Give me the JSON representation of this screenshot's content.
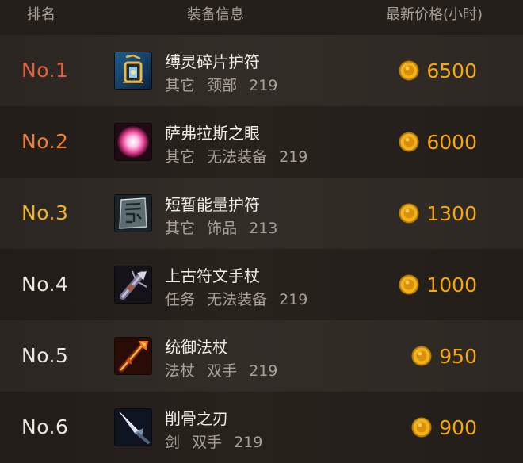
{
  "header": {
    "rank": "排名",
    "info": "装备信息",
    "price": "最新价格(小时)"
  },
  "colors": {
    "no1": "#e0603c",
    "no2": "#eb7f37",
    "no3": "#f0b324",
    "default": "#ece6df",
    "price": "#f4a80c"
  },
  "items": [
    {
      "rank": "No.1",
      "name": "缚灵碎片护符",
      "type": "其它",
      "slot": "颈部",
      "level": "219",
      "price": "6500",
      "icon": "amulet-icon"
    },
    {
      "rank": "No.2",
      "name": "萨弗拉斯之眼",
      "type": "其它",
      "slot": "无法装备",
      "level": "219",
      "price": "6000",
      "icon": "glowing-orb-icon"
    },
    {
      "rank": "No.3",
      "name": "短暂能量护符",
      "type": "其它",
      "slot": "饰品",
      "level": "213",
      "price": "1300",
      "icon": "rune-tablet-icon"
    },
    {
      "rank": "No.4",
      "name": "上古符文手杖",
      "type": "任务",
      "slot": "无法装备",
      "level": "219",
      "price": "1000",
      "icon": "rune-staff-icon"
    },
    {
      "rank": "No.5",
      "name": "统御法杖",
      "type": "法杖",
      "slot": "双手",
      "level": "219",
      "price": "950",
      "icon": "fire-staff-icon"
    },
    {
      "rank": "No.6",
      "name": "削骨之刃",
      "type": "剑",
      "slot": "双手",
      "level": "219",
      "price": "900",
      "icon": "bone-blade-icon"
    }
  ]
}
